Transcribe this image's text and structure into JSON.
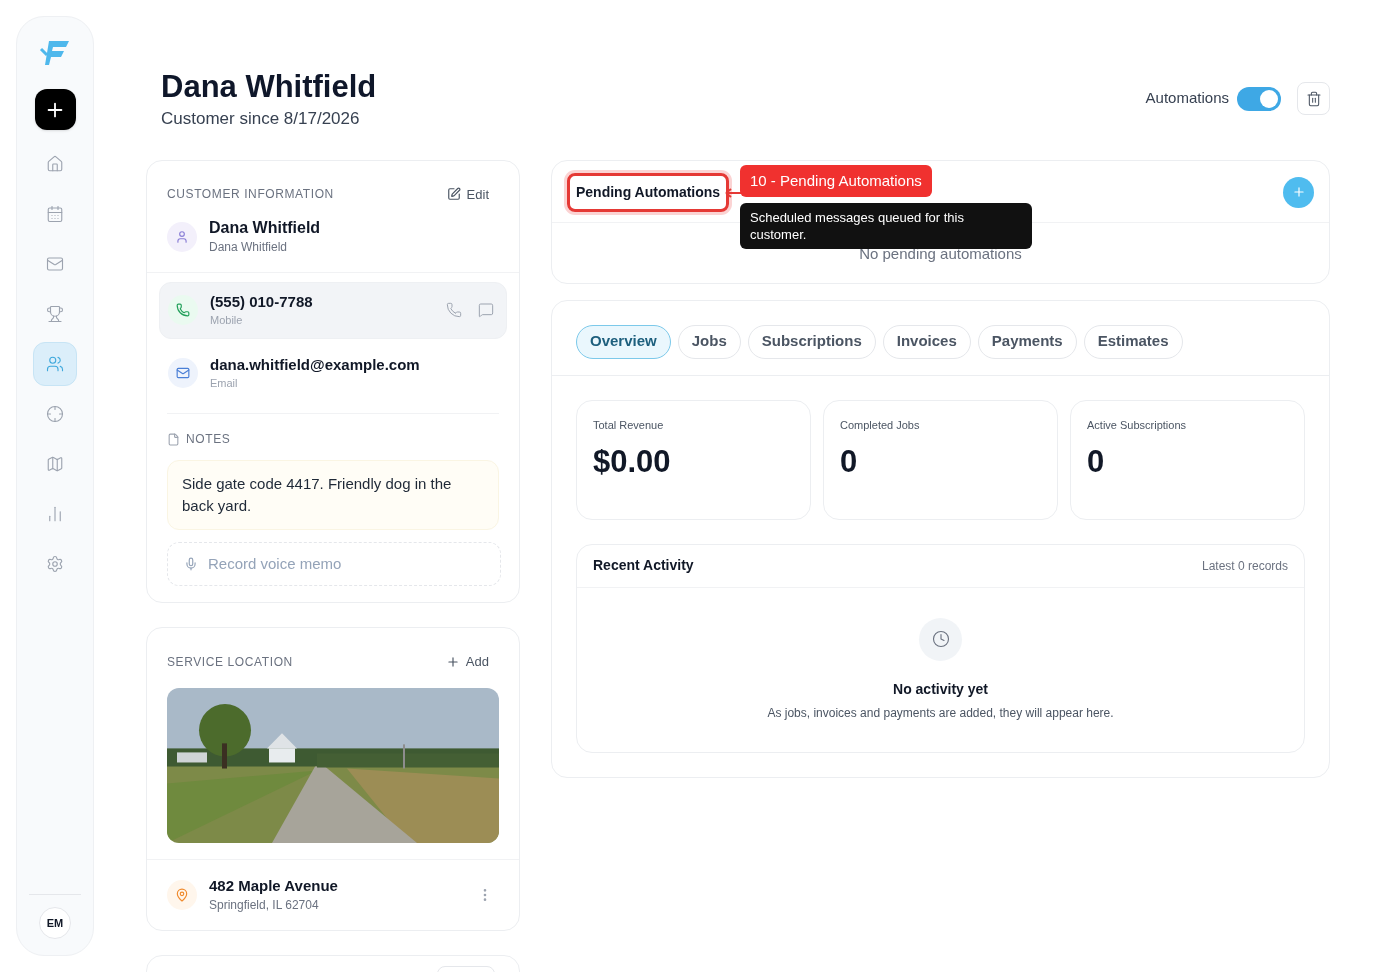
{
  "sidebar": {
    "items": [
      {
        "kind": "home",
        "selected": false
      },
      {
        "kind": "calendar",
        "selected": false
      },
      {
        "kind": "mail",
        "selected": false
      },
      {
        "kind": "trophy",
        "selected": false
      },
      {
        "kind": "users",
        "selected": true
      },
      {
        "kind": "target",
        "selected": false
      },
      {
        "kind": "map",
        "selected": false
      },
      {
        "kind": "chart",
        "selected": false
      },
      {
        "kind": "settings",
        "selected": false
      }
    ],
    "user_badge": "EM"
  },
  "header": {
    "name": "Dana Whitfield",
    "since": "Customer since 8/17/2026",
    "automations_label": "Automations",
    "automations_on": true
  },
  "customer_information": {
    "title": "CUSTOMER INFORMATION",
    "edit": "Edit",
    "name": "Dana Whitfield",
    "subname": "Dana Whitfield",
    "contacts": [
      {
        "kind": "phone",
        "value": "(555) 010-7788",
        "label": "Mobile",
        "highlighted": true
      },
      {
        "kind": "email",
        "value": "dana.whitfield@example.com",
        "label": "Email",
        "highlighted": false
      }
    ],
    "notes_title": "NOTES",
    "notes": "Side gate code 4417. Friendly dog in the back yard.",
    "voice_memo": "Record voice memo"
  },
  "service_location": {
    "title": "SERVICE LOCATION",
    "add": "Add",
    "address": "482 Maple Avenue",
    "city": "Springfield, IL 62704"
  },
  "pending_automations": {
    "title": "Pending Automations",
    "empty": "No pending automations",
    "annotation": "10 - Pending Automations",
    "tooltip": "Scheduled messages queued for this customer."
  },
  "tabs": [
    {
      "label": "Overview",
      "selected": true
    },
    {
      "label": "Jobs",
      "selected": false
    },
    {
      "label": "Subscriptions",
      "selected": false
    },
    {
      "label": "Invoices",
      "selected": false
    },
    {
      "label": "Payments",
      "selected": false
    },
    {
      "label": "Estimates",
      "selected": false
    }
  ],
  "stats": [
    {
      "label": "Total Revenue",
      "value": "$0.00"
    },
    {
      "label": "Completed Jobs",
      "value": "0"
    },
    {
      "label": "Active Subscriptions",
      "value": "0"
    }
  ],
  "recent_activity": {
    "title": "Recent Activity",
    "meta": "Latest 0 records",
    "empty_title": "No activity yet",
    "empty_text": "As jobs, invoices and payments are added, they will appear here."
  }
}
